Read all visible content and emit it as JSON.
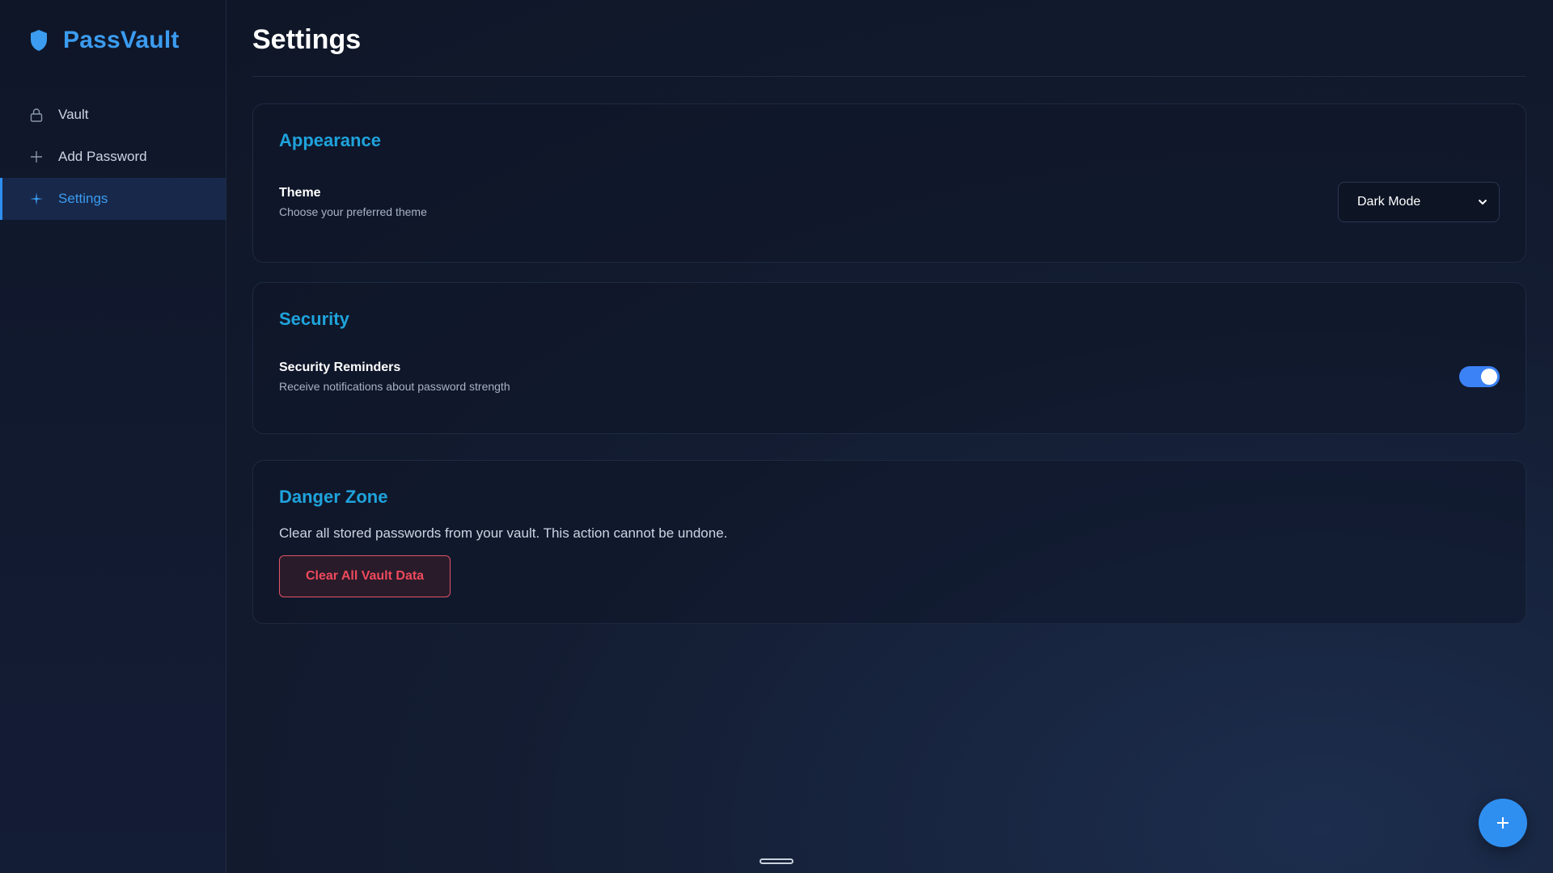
{
  "brand": {
    "name": "PassVault",
    "icon": "shield-icon"
  },
  "sidebar": {
    "items": [
      {
        "label": "Vault",
        "icon": "lock-icon",
        "active": false
      },
      {
        "label": "Add Password",
        "icon": "plus-icon",
        "active": false
      },
      {
        "label": "Settings",
        "icon": "sparkle-icon",
        "active": true
      }
    ]
  },
  "page": {
    "title": "Settings"
  },
  "appearance": {
    "title": "Appearance",
    "theme_label": "Theme",
    "theme_desc": "Choose your preferred theme",
    "theme_value": "Dark Mode"
  },
  "security": {
    "title": "Security",
    "reminders_label": "Security Reminders",
    "reminders_desc": "Receive notifications about password strength",
    "reminders_enabled": true
  },
  "danger": {
    "title": "Danger Zone",
    "text": "Clear all stored passwords from your vault. This action cannot be undone.",
    "button_label": "Clear All Vault Data"
  },
  "fab": {
    "icon": "plus-icon"
  },
  "colors": {
    "accent": "#3b9cf0",
    "section_title": "#1fa3dc",
    "danger": "#ef4a5d",
    "toggle_on": "#3b82f6"
  }
}
